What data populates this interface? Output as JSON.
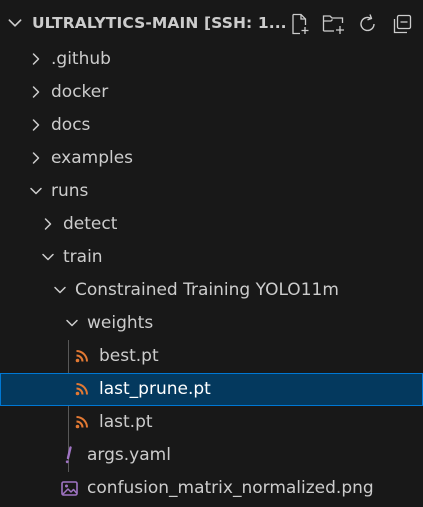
{
  "explorer": {
    "title": "ULTRALYTICS-MAIN [SSH: 1...",
    "actions": [
      {
        "name": "new-file-icon"
      },
      {
        "name": "new-folder-icon"
      },
      {
        "name": "refresh-icon"
      },
      {
        "name": "collapse-all-icon"
      }
    ]
  },
  "tree": {
    "items": [
      {
        "label": ".github",
        "kind": "folder",
        "expanded": false
      },
      {
        "label": "docker",
        "kind": "folder",
        "expanded": false
      },
      {
        "label": "docs",
        "kind": "folder",
        "expanded": false
      },
      {
        "label": "examples",
        "kind": "folder",
        "expanded": false
      },
      {
        "label": "runs",
        "kind": "folder",
        "expanded": true
      },
      {
        "label": "detect",
        "kind": "folder",
        "expanded": false
      },
      {
        "label": "train",
        "kind": "folder",
        "expanded": true
      },
      {
        "label": "Constrained Training YOLO11m",
        "kind": "folder",
        "expanded": true
      },
      {
        "label": "weights",
        "kind": "folder",
        "expanded": true
      },
      {
        "label": "best.pt",
        "kind": "file",
        "icon": "rss-icon"
      },
      {
        "label": "last_prune.pt",
        "kind": "file",
        "icon": "rss-icon",
        "selected": true
      },
      {
        "label": "last.pt",
        "kind": "file",
        "icon": "rss-icon"
      },
      {
        "label": "args.yaml",
        "kind": "file",
        "icon": "exclamation-icon"
      },
      {
        "label": "confusion_matrix_normalized.png",
        "kind": "file",
        "icon": "image-icon"
      }
    ]
  },
  "colors": {
    "background": "#181818",
    "selection": "#04395e",
    "selection_border": "#0078d4",
    "rss_icon": "#e37933",
    "yaml_icon": "#a074c4",
    "image_icon": "#a074c4",
    "text": "#cccccc"
  }
}
